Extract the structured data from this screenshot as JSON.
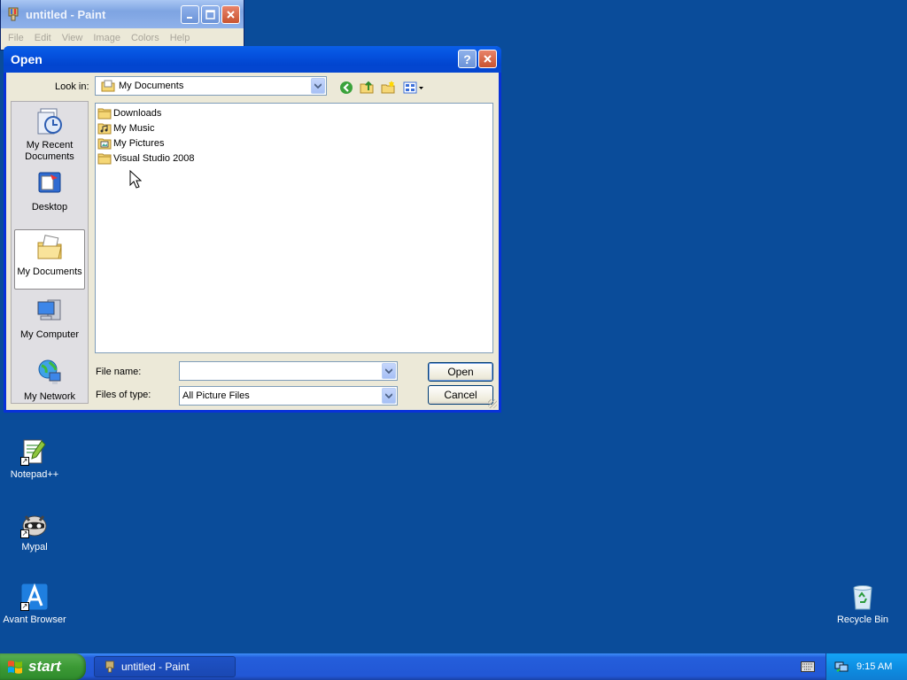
{
  "paint": {
    "title": "untitled - Paint",
    "menu": [
      "File",
      "Edit",
      "View",
      "Image",
      "Colors",
      "Help"
    ]
  },
  "dialog": {
    "title": "Open",
    "look_in_label": "Look in:",
    "look_in_value": "My Documents",
    "places": [
      {
        "label": "My Recent Documents",
        "icon": "recent-documents-icon"
      },
      {
        "label": "Desktop",
        "icon": "desktop-icon"
      },
      {
        "label": "My Documents",
        "icon": "my-documents-icon",
        "selected": true
      },
      {
        "label": "My Computer",
        "icon": "my-computer-icon"
      },
      {
        "label": "My Network",
        "icon": "my-network-icon"
      }
    ],
    "files": [
      "Downloads",
      "My Music",
      "My Pictures",
      "Visual Studio 2008"
    ],
    "file_name_label": "File name:",
    "file_name_value": "",
    "file_type_label": "Files of type:",
    "file_type_value": "All Picture Files",
    "open_label": "Open",
    "cancel_label": "Cancel"
  },
  "desktop_icons": [
    {
      "label": "Notepad++",
      "icon": "notepadpp-icon"
    },
    {
      "label": "Mypal",
      "icon": "mypal-icon"
    },
    {
      "label": "Avant Browser",
      "icon": "avant-browser-icon"
    },
    {
      "label": "Recycle Bin",
      "icon": "recycle-bin-icon"
    }
  ],
  "taskbar": {
    "start_label": "start",
    "task_label": "untitled - Paint",
    "clock": "9:15 AM"
  },
  "colors": {
    "desktop": "#0a4c9a",
    "title_blue": "#0553e0",
    "taskbar_blue": "#245edb",
    "start_green": "#3c9a35"
  }
}
